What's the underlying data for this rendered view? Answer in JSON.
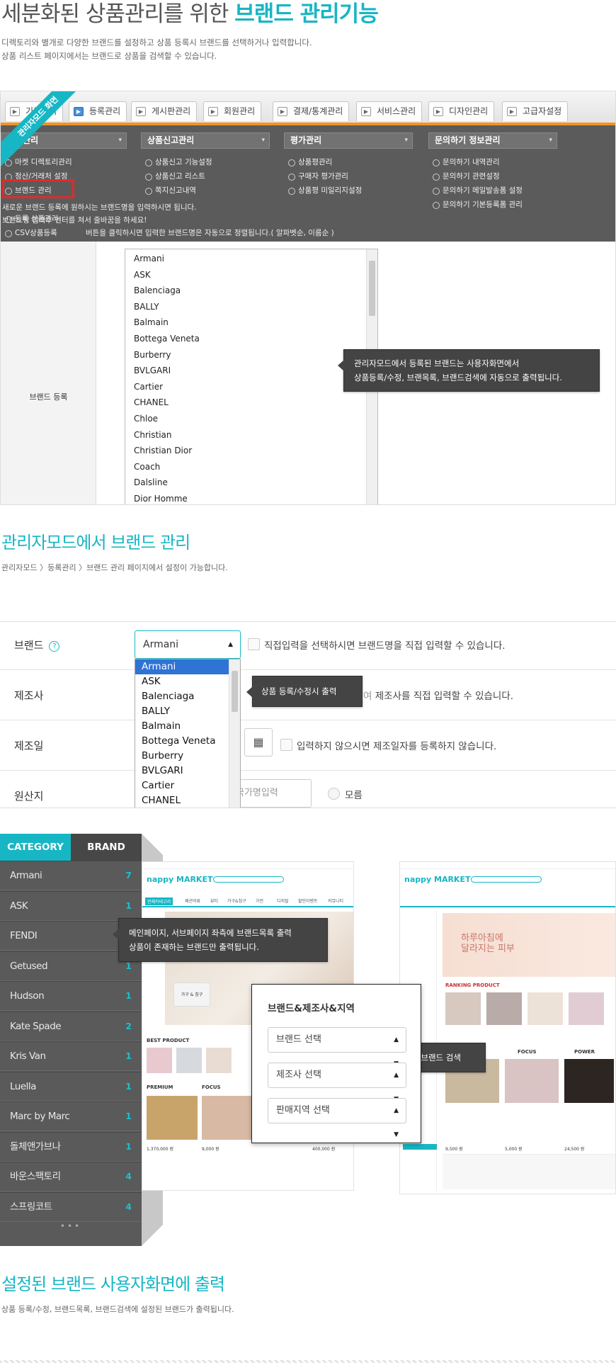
{
  "hero": {
    "title_prefix": "세분화된 상품관리를 위한 ",
    "title_highlight": "브랜드 관리기능",
    "desc_line1": "디렉토리와 별개로 다양한 브랜드를 설정하고 상품 등록시 브랜드를 선택하거나 입력합니다.",
    "desc_line2": "상품 리스트 페이지에서는 브랜드로 상품을 검색할 수 있습니다."
  },
  "admin": {
    "ribbon": "관리자모드 화면",
    "tabs": [
      {
        "label": "기본관리"
      },
      {
        "label": "등록관리"
      },
      {
        "label": "게시판관리"
      },
      {
        "label": "회원관리"
      },
      {
        "label": "결제/통계관리"
      },
      {
        "label": "서비스관리"
      },
      {
        "label": "디자인관리"
      },
      {
        "label": "고급자설정"
      }
    ],
    "menu_groups": [
      {
        "head": "등록관리",
        "items": [
          "마켓 디렉토리관리",
          "정산/거래처 설정",
          "브랜드 관리"
        ]
      },
      {
        "head": "상품신고관리",
        "items": [
          "상품신고 기능설정",
          "상품신고 리스트",
          "쪽지신고내역"
        ]
      },
      {
        "head": "평가관리",
        "items": [
          "상품평관리",
          "구매자 평가관리",
          "상품평 미일리지설정"
        ]
      },
      {
        "head": "문의하기 정보관리",
        "items": [
          "문의하기 내역관리",
          "문의하기 관련설정",
          "문의하기 메일발송폼 설정",
          "문의하기 기본등록폼 관리"
        ]
      }
    ],
    "extra_items": [
      "등록 상품관리",
      "CSV상품등록"
    ],
    "notice_lines": [
      "새로운 브랜드 등록에 원하시는 브랜드명을 입력하시면 됩니다.",
      "브랜드명 입력후 엔터를 쳐서 줄바꿈을 하세요!",
      "버튼을 클릭하시면 입력한 브랜드명은 자동으로 정렬됩니다.( 알파벳순, 이름순 )"
    ],
    "brand_label": "브랜드 등록",
    "brand_list": [
      "Armani",
      "ASK",
      "Balenciaga",
      "BALLY",
      "Balmain",
      "Bottega Veneta",
      "Burberry",
      "BVLGARI",
      "Cartier",
      "CHANEL",
      "Chloe",
      "Christian",
      "Christian Dior",
      "Coach",
      "Dalsline",
      "Dior Homme"
    ],
    "tooltip_line1": "관리자모드에서 등록된 브랜드는 사용자화면에서",
    "tooltip_line2": "상품등록/수정, 브랜목록, 브랜드검색에 자동으로 출력됩니다."
  },
  "section2": {
    "title": "관리자모드에서 브랜드 관리",
    "breadcrumb": "관리자모드 〉등록관리 〉브랜드 관리 페이지에서 설정이 가능합니다."
  },
  "form": {
    "brand_label": "브랜드",
    "help": "?",
    "selected": "Armani",
    "brand_note": "직접입력을 선택하시면 브랜드명을 직접 입력할 수 있습니다.",
    "dropdown_options": [
      "Armani",
      "ASK",
      "Balenciaga",
      "BALLY",
      "Balmain",
      "Bottega Veneta",
      "Burberry",
      "BVLGARI",
      "Cartier",
      "CHANEL"
    ],
    "maker_label": "제조사",
    "maker_note": "제조사를 직접 입력할 수 있습니다.",
    "tooltip": "상품 등록/수정시 출력",
    "tooltip_tail": "여",
    "date_label": "제조일",
    "date_note": "입력하지 않으시면 제조일자를 등록하지 않습니다.",
    "origin_label": "원산지",
    "origin_placeholder": "국가명입력",
    "unknown": "모름"
  },
  "category_panel": {
    "tab_category": "CATEGORY",
    "tab_brand": "BRAND",
    "rows": [
      {
        "name": "Armani",
        "count": "7"
      },
      {
        "name": "ASK",
        "count": "1"
      },
      {
        "name": "FENDI",
        "count": "1"
      },
      {
        "name": "Getused",
        "count": "1"
      },
      {
        "name": "Hudson",
        "count": "1"
      },
      {
        "name": "Kate Spade",
        "count": "2"
      },
      {
        "name": "Kris Van",
        "count": "1"
      },
      {
        "name": "Luella",
        "count": "1"
      },
      {
        "name": "Marc by Marc",
        "count": "1"
      },
      {
        "name": "돌체앤가브나",
        "count": "1"
      },
      {
        "name": "바운스팩토리",
        "count": "4"
      },
      {
        "name": "스프링코트",
        "count": "4"
      }
    ],
    "more": "•••"
  },
  "shop_preview": {
    "logo": "nappy MARKET",
    "nav": [
      "전체카테고리",
      "패션의류",
      "뷰티",
      "가구&침구",
      "가전",
      "디지털",
      "할인이벤트",
      "커뮤니티"
    ],
    "best_product": "BEST PRODUCT",
    "premium": "PREMIUM",
    "focus": "FOCUS",
    "power": "POWER",
    "ranking": "RANKING PRODUCT",
    "banner_text_1": "하루아침에",
    "banner_text_2": "달라지는 피부",
    "furniture": "가구 & 침구",
    "price_1": "1,370,000 원",
    "price_2": "9,000 원",
    "price_3": "400,000 원",
    "price_4": "9,500 원",
    "price_5": "5,000 원",
    "price_6": "24,500 원",
    "tooltip_main_1": "메인페이지, 서브페이지 좌측에 브랜드목록 출력",
    "tooltip_main_2": "상품이 존재하는 브랜드만 출력됩니다.",
    "tooltip_sub": "서브페이지 좌측 브랜드 검색"
  },
  "filter_panel": {
    "title": "브랜드&제조사&지역",
    "select_brand": "브랜드 선택",
    "select_maker": "제조사 선택",
    "select_region": "판매지역 선택"
  },
  "section3": {
    "title": "설정된 브랜드 사용자화면에 출력",
    "desc": "상품 등록/수정, 브랜드목록, 브랜드검색에 설정된 브랜드가 출력됩니다."
  },
  "colors": {
    "accent": "#17b6c4",
    "admin_orange": "#f39322",
    "dark_panel": "#5a5a5a",
    "highlight_red": "#e02b2b"
  }
}
